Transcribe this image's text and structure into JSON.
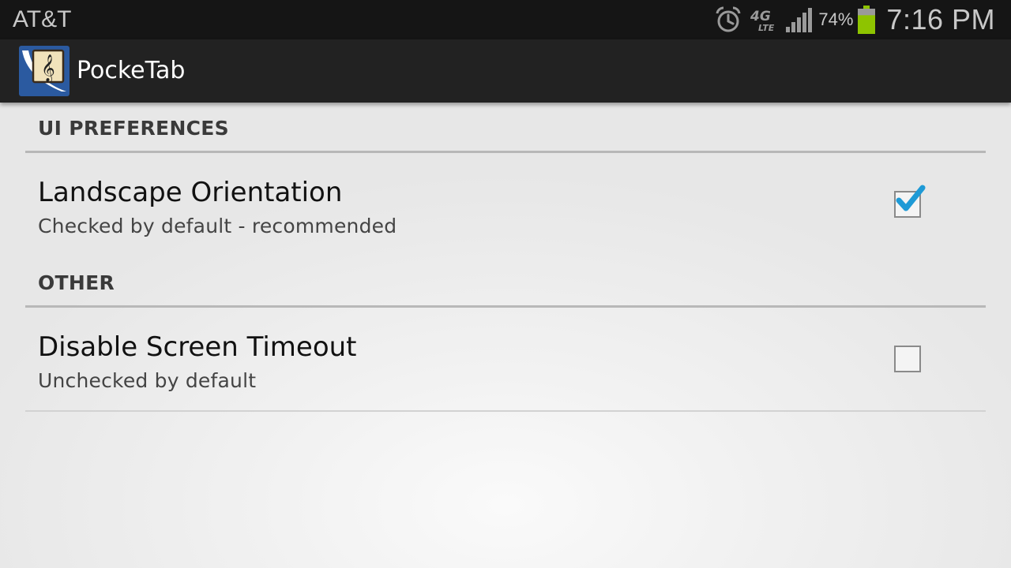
{
  "status_bar": {
    "carrier": "AT&T",
    "network_type": "4G LTE",
    "battery_percent": "74%",
    "time": "7:16 PM",
    "icons": [
      "alarm-icon",
      "lte-icon",
      "signal-icon",
      "battery-icon"
    ],
    "battery_color": "#8ec400"
  },
  "action_bar": {
    "title": "PockeTab",
    "icon": "pocketab-app-icon"
  },
  "preferences": {
    "ui_category": {
      "title": "UI PREFERENCES",
      "items": [
        {
          "title": "Landscape Orientation",
          "summary": "Checked by default - recommended",
          "checked": true
        }
      ]
    },
    "other_category": {
      "title": "OTHER",
      "items": [
        {
          "title": "Disable Screen Timeout",
          "summary": "Unchecked by default",
          "checked": false
        }
      ]
    }
  },
  "colors": {
    "check_accent": "#1e9ad6",
    "action_bar_bg": "#222222",
    "status_bar_bg": "#151515"
  }
}
